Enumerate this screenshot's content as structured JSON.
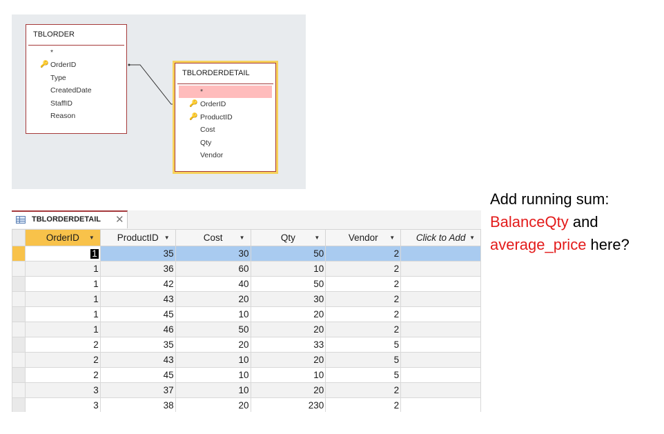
{
  "diagram": {
    "tbl_order": {
      "title": "TBLORDER",
      "fields": [
        {
          "name": "*",
          "key": false
        },
        {
          "name": "OrderID",
          "key": true
        },
        {
          "name": "Type",
          "key": false
        },
        {
          "name": "CreatedDate",
          "key": false
        },
        {
          "name": "StaffID",
          "key": false
        },
        {
          "name": "Reason",
          "key": false
        }
      ]
    },
    "tbl_orderdetail": {
      "title": "TBLORDERDETAIL",
      "fields": [
        {
          "name": "*",
          "key": false,
          "highlighted": true
        },
        {
          "name": "OrderID",
          "key": true
        },
        {
          "name": "ProductID",
          "key": true
        },
        {
          "name": "Cost",
          "key": false
        },
        {
          "name": "Qty",
          "key": false
        },
        {
          "name": "Vendor",
          "key": false
        }
      ]
    },
    "key_glyph": "🔑",
    "colors": {
      "border": "#a53838",
      "selected_outline": "#f7d25a",
      "highlight": "#ffbcbc",
      "background": "#e8ebee"
    }
  },
  "datasheet": {
    "tab_title": "TBLORDERDETAIL",
    "close_glyph": "✕",
    "dropdown_glyph": "▼",
    "columns": [
      "OrderID",
      "ProductID",
      "Cost",
      "Qty",
      "Vendor",
      "Click to Add"
    ],
    "rows": [
      [
        "1",
        "35",
        "30",
        "50",
        "2"
      ],
      [
        "1",
        "36",
        "60",
        "10",
        "2"
      ],
      [
        "1",
        "42",
        "40",
        "50",
        "2"
      ],
      [
        "1",
        "43",
        "20",
        "30",
        "2"
      ],
      [
        "1",
        "45",
        "10",
        "20",
        "2"
      ],
      [
        "1",
        "46",
        "50",
        "20",
        "2"
      ],
      [
        "2",
        "35",
        "20",
        "33",
        "5"
      ],
      [
        "2",
        "43",
        "10",
        "20",
        "5"
      ],
      [
        "2",
        "45",
        "10",
        "10",
        "5"
      ],
      [
        "3",
        "37",
        "10",
        "20",
        "2"
      ],
      [
        "3",
        "38",
        "20",
        "230",
        "2"
      ]
    ],
    "colors": {
      "current_row": "#a9cbf0",
      "selector_active": "#f8c24a",
      "tab_accent": "#a4373a"
    }
  },
  "annotation": {
    "line1": "Add running sum:",
    "field1": "BalanceQty",
    "and_word": " and",
    "field2": "average_price",
    "tail": " here?",
    "highlight_color": "#e31b1b"
  }
}
